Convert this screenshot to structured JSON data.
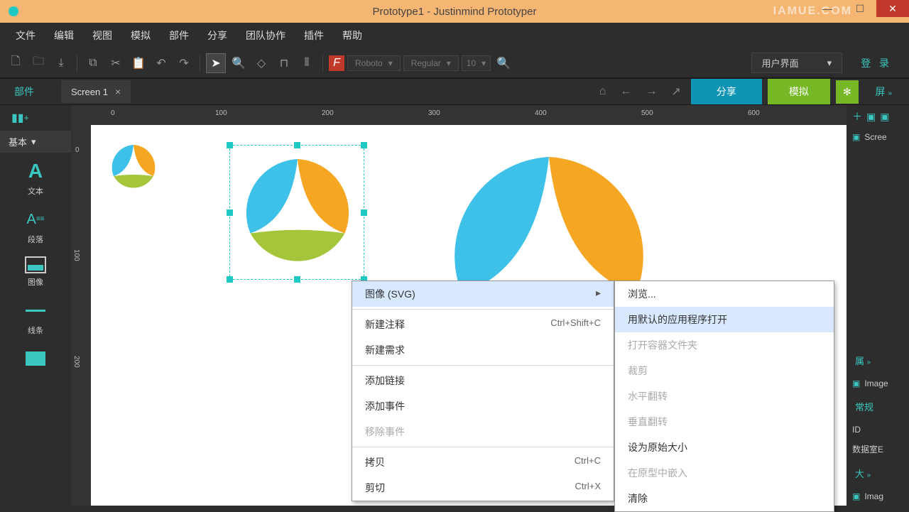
{
  "title": "Prototype1 - Justinmind Prototyper",
  "watermark": "IAMUE.COM",
  "menu": [
    "文件",
    "编辑",
    "视图",
    "模拟",
    "部件",
    "分享",
    "团队协作",
    "插件",
    "帮助"
  ],
  "font": {
    "family": "Roboto",
    "weight": "Regular",
    "size": "10"
  },
  "view_mode": "用户界面",
  "login": "登 录",
  "panel_components": "部件",
  "tab": "Screen 1",
  "btn_share": "分享",
  "btn_simulate": "模拟",
  "screens_label": "屏",
  "left_category": "基本",
  "widgets": {
    "text": "文本",
    "paragraph": "段落",
    "image": "图像",
    "line": "线条"
  },
  "ruler_h": [
    "0",
    "100",
    "200",
    "300",
    "400",
    "500",
    "600"
  ],
  "ruler_v": [
    "0",
    "100",
    "200"
  ],
  "right_panel": {
    "screens_item": "Scree",
    "props": "属",
    "image_label": "Image",
    "general": "常规",
    "id_label": "ID",
    "data_label": "数据室E",
    "size_label": "大",
    "imag2": "Imag"
  },
  "context1": {
    "image_svg": "图像 (SVG)",
    "new_note": "新建注释",
    "new_note_sc": "Ctrl+Shift+C",
    "new_req": "新建需求",
    "add_link": "添加链接",
    "add_event": "添加事件",
    "remove_event": "移除事件",
    "copy": "拷贝",
    "copy_sc": "Ctrl+C",
    "cut": "剪切",
    "cut_sc": "Ctrl+X"
  },
  "context2": {
    "browse": "浏览...",
    "open_default": "用默认的应用程序打开",
    "open_folder": "打开容器文件夹",
    "crop": "裁剪",
    "flip_h": "水平翻转",
    "flip_v": "垂直翻转",
    "orig_size": "设为原始大小",
    "embed": "在原型中嵌入",
    "clear": "清除"
  }
}
